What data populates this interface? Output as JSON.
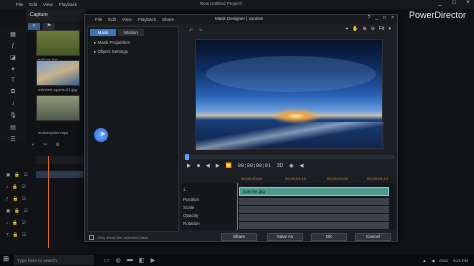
{
  "app": {
    "menu": [
      "File",
      "Edit",
      "View",
      "Playback"
    ],
    "title": "New Untitled Project*",
    "brand": "PowerDirector",
    "window_controls": [
      "_",
      "□",
      "×"
    ]
  },
  "library": {
    "header": "Capture",
    "items": [
      {
        "label": "ballons.jpg"
      },
      {
        "label": "extreme-sports-01.jpg"
      },
      {
        "label": "motorcycles.mpo"
      }
    ]
  },
  "taskbar": {
    "search_placeholder": "Type here to search",
    "time": "5:21 PM",
    "lang": "ENG"
  },
  "dialog": {
    "title": "Mask Designer | sunrise",
    "menu": [
      "File",
      "Edit",
      "View",
      "Playback",
      "Share"
    ],
    "tabs": [
      {
        "label": "Mask",
        "active": true
      },
      {
        "label": "Motion",
        "active": false
      }
    ],
    "properties": [
      "Mask Properties",
      "Object Settings"
    ],
    "only_selected_label": "Only show the selected track",
    "zoom": "Fit",
    "player": {
      "timecode": "00;00;00;01",
      "mode": "3D"
    },
    "timeline": {
      "ruler": [
        "00;00;00;00",
        "00;00;01;10",
        "00;00;03;00",
        "00;00;04;10"
      ],
      "rows": [
        "1.",
        "Position",
        "Scale",
        "Opacity",
        "Rotation"
      ],
      "clip_label": "sunrise.jpg"
    },
    "buttons": {
      "share": "Share",
      "save_as": "Save As",
      "ok": "OK",
      "cancel": "Cancel"
    }
  }
}
